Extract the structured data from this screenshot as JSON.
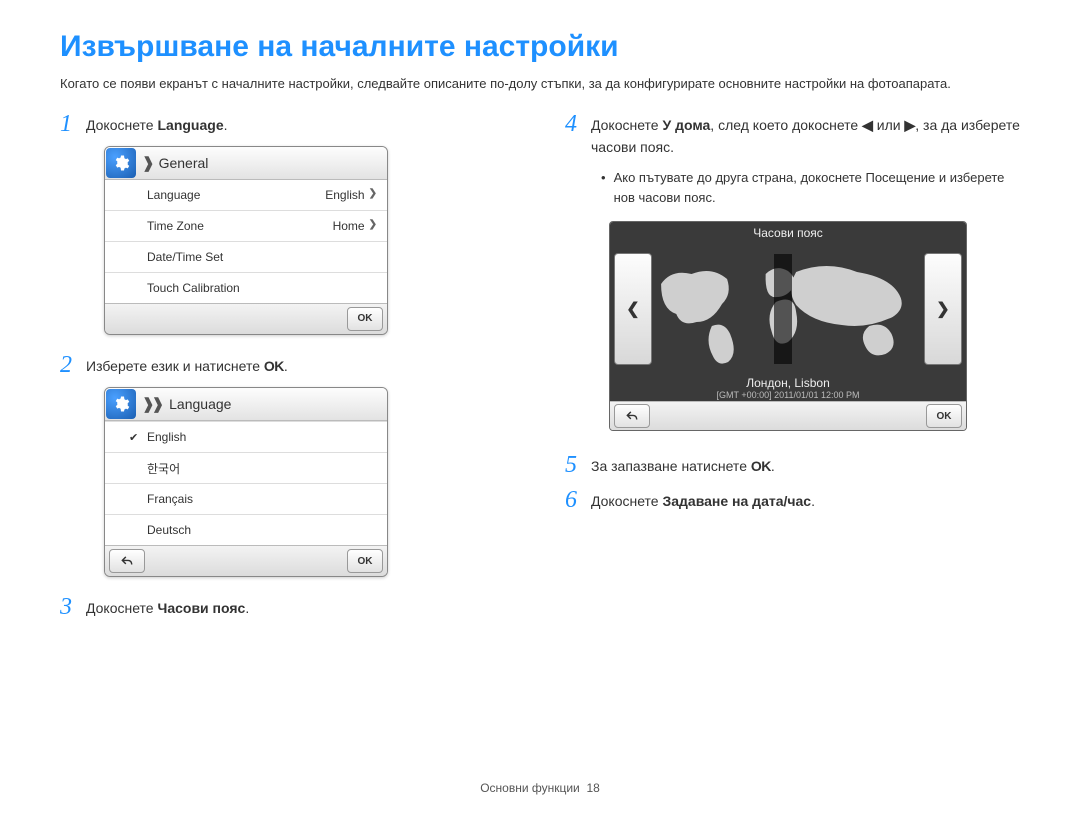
{
  "page": {
    "title": "Извършване на началните настройки",
    "intro": "Когато се появи екранът с началните настройки, следвайте описаните по-долу стъпки, за да конфигурирате основните настройки на фотоапарата.",
    "footer_section": "Основни функции",
    "footer_page": "18"
  },
  "steps": {
    "s1": {
      "num": "1",
      "pre": "Докоснете ",
      "bold": "Language",
      "post": "."
    },
    "s2": {
      "num": "2",
      "text": "Изберете език и натиснете ",
      "ok": "OK",
      "post": "."
    },
    "s3": {
      "num": "3",
      "pre": "Докоснете ",
      "bold": "Часови пояс",
      "post": "."
    },
    "s4": {
      "num": "4",
      "pre": "Докоснете ",
      "bold1": "У дома",
      "mid": ", след което докоснете ",
      "mid2": " или ",
      "post": ", за да изберете часови пояс."
    },
    "s4sub": {
      "pre": "Ако пътувате до друга страна, докоснете ",
      "bold": "Посещение",
      "post": " и изберете нов часови пояс."
    },
    "s5": {
      "num": "5",
      "text": "За запазване натиснете ",
      "ok": "OK",
      "post": "."
    },
    "s6": {
      "num": "6",
      "pre": "Докоснете ",
      "bold": "Задаване на дата/час",
      "post": "."
    }
  },
  "device1": {
    "header": "General",
    "rows": [
      {
        "label": "Language",
        "value": "English"
      },
      {
        "label": "Time Zone",
        "value": "Home"
      },
      {
        "label": "Date/Time Set",
        "value": ""
      },
      {
        "label": "Touch Calibration",
        "value": ""
      }
    ],
    "ok": "OK"
  },
  "device2": {
    "header": "Language",
    "langs": [
      "English",
      "한국어",
      "Français",
      "Deutsch"
    ],
    "ok": "OK"
  },
  "mapdev": {
    "title": "Часови пояс",
    "city": "Лондон, Lisbon",
    "gmt": "[GMT +00:00] 2011/01/01 12:00 PM",
    "ok": "OK"
  }
}
